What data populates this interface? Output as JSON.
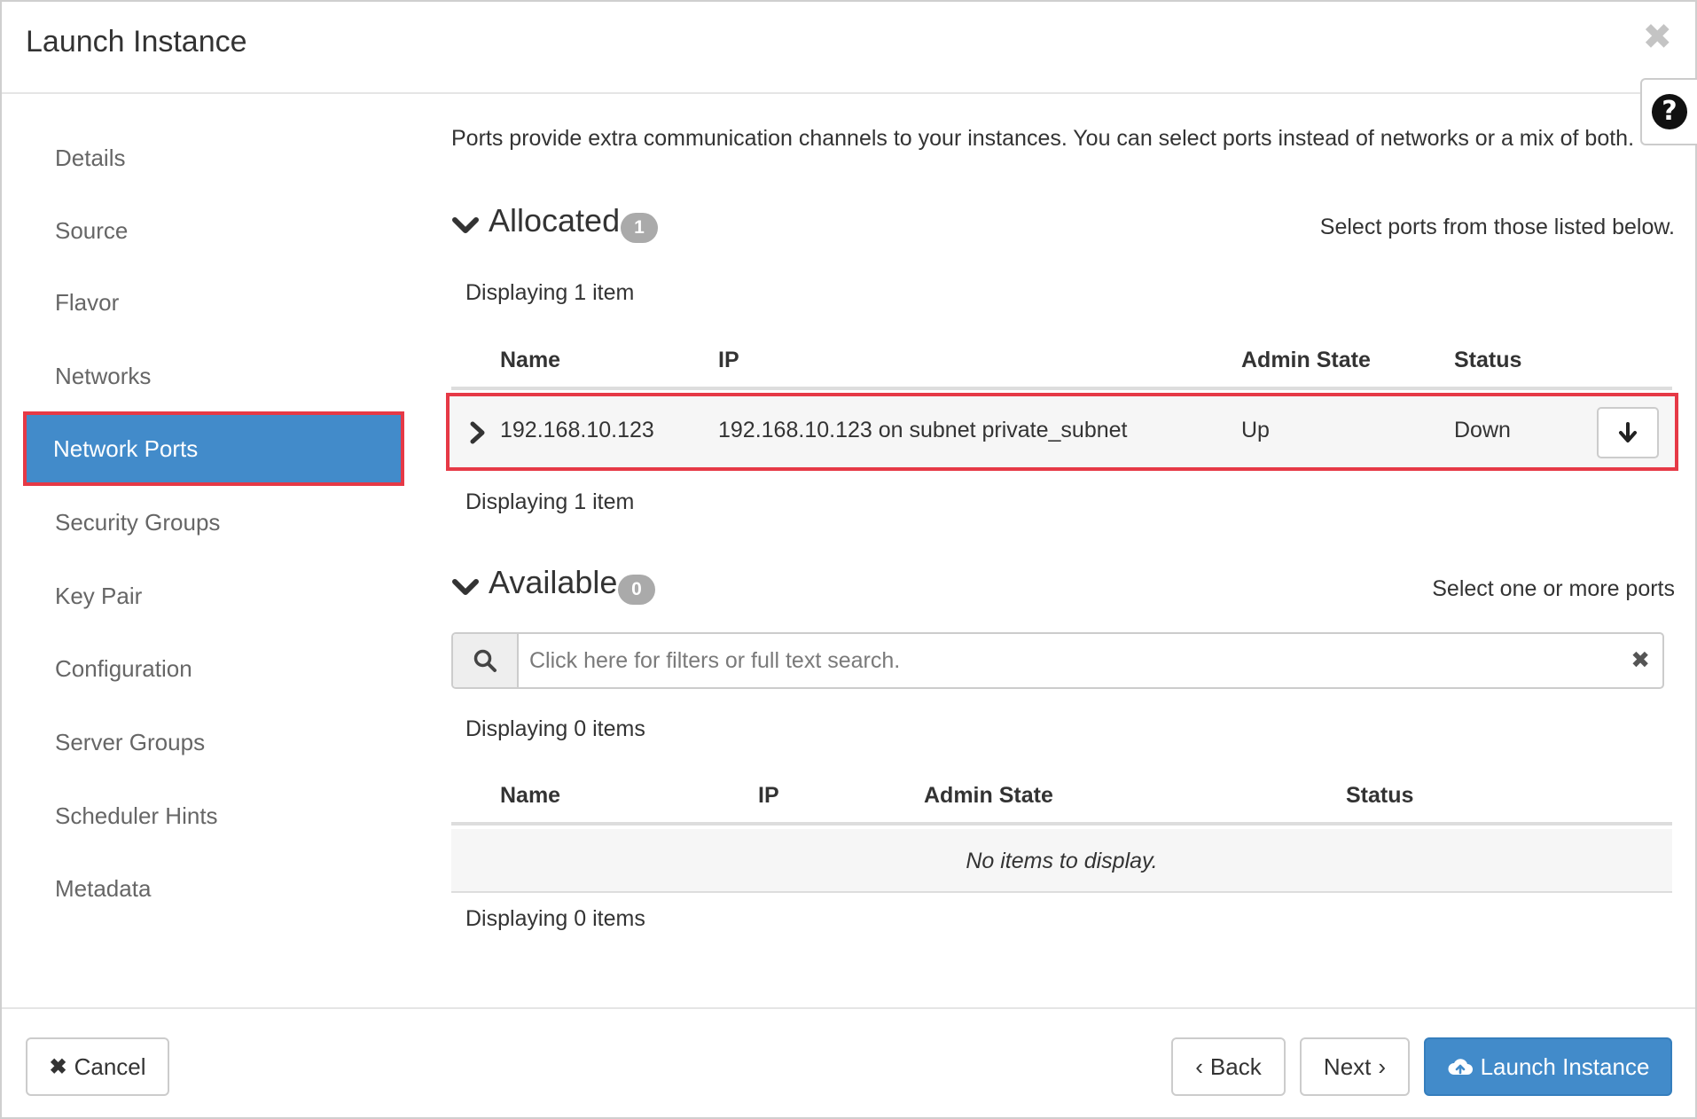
{
  "dialog": {
    "title": "Launch Instance",
    "close_icon": "close-icon",
    "help_icon": "question-circle-icon"
  },
  "sidebar": {
    "items": [
      {
        "label": "Details"
      },
      {
        "label": "Source"
      },
      {
        "label": "Flavor"
      },
      {
        "label": "Networks"
      },
      {
        "label": "Network Ports",
        "active": true
      },
      {
        "label": "Security Groups"
      },
      {
        "label": "Key Pair"
      },
      {
        "label": "Configuration"
      },
      {
        "label": "Server Groups"
      },
      {
        "label": "Scheduler Hints"
      },
      {
        "label": "Metadata"
      }
    ]
  },
  "main": {
    "intro": "Ports provide extra communication channels to your instances. You can select ports instead of networks or a mix of both.",
    "allocated": {
      "title": "Allocated",
      "count": "1",
      "hint": "Select ports from those listed below.",
      "display_top": "Displaying 1 item",
      "display_bottom": "Displaying 1 item",
      "columns": [
        "Name",
        "IP",
        "Admin State",
        "Status"
      ],
      "rows": [
        {
          "name": "192.168.10.123",
          "ip": "192.168.10.123 on subnet private_subnet",
          "admin_state": "Up",
          "status": "Down"
        }
      ]
    },
    "available": {
      "title": "Available",
      "count": "0",
      "hint": "Select one or more ports",
      "search_placeholder": "Click here for filters or full text search.",
      "display_top": "Displaying 0 items",
      "display_bottom": "Displaying 0 items",
      "columns": [
        "Name",
        "IP",
        "Admin State",
        "Status"
      ],
      "empty_text": "No items to display."
    }
  },
  "footer": {
    "cancel": "Cancel",
    "back": "Back",
    "next": "Next",
    "launch": "Launch Instance"
  },
  "colors": {
    "primary": "#428bca",
    "highlight": "#e63946",
    "badge": "#aaaaaa"
  }
}
